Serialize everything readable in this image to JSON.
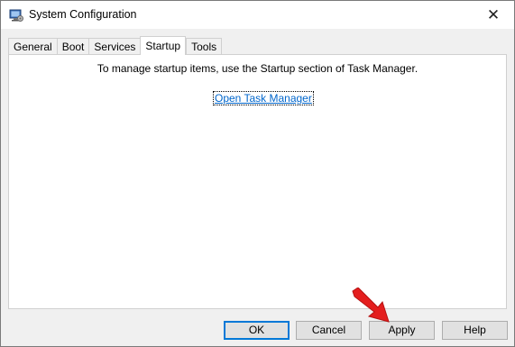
{
  "window": {
    "title": "System Configuration",
    "close_glyph": "✕"
  },
  "tabs": [
    {
      "label": "General"
    },
    {
      "label": "Boot"
    },
    {
      "label": "Services"
    },
    {
      "label": "Startup",
      "active": true
    },
    {
      "label": "Tools"
    }
  ],
  "startup": {
    "message": "To manage startup items, use the Startup section of Task Manager.",
    "link_label": "Open Task Manager"
  },
  "buttons": {
    "ok": "OK",
    "cancel": "Cancel",
    "apply": "Apply",
    "help": "Help"
  },
  "annotation": {
    "arrow_color": "#e41e1e",
    "points_to": "apply-button"
  }
}
